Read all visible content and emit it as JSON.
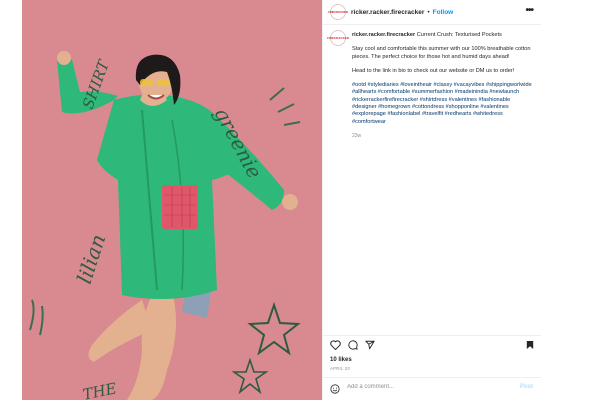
{
  "post_image": {
    "handwriting": [
      "SHIRT",
      "greenie",
      "lilian",
      "THE"
    ]
  },
  "header": {
    "avatar_text": "FIRECRACKER",
    "username": "ricker.racker.firecracker",
    "separator": "•",
    "follow_label": "Follow",
    "more_label": "•••"
  },
  "caption": {
    "avatar_text": "FIRECRACKER",
    "username": "ricker.racker.firecracker",
    "title": "Current Crush: Texturised Pockets",
    "paragraph1": "Stay cool and comfortable this summer with our 100% breathable cotton pieces. The perfect choice for those hot and humid days ahead!",
    "paragraph2": "Head to the link in bio to check out our website or DM us to order!",
    "hashtags": "#ootd #stylediaries #loveintheair #classy #vacayvibes #shippingworlwide #allhearts #comfortable #summerfashion #madeinindia #newlaunch #rickerrackerfirefirecracker #shirtdress #valentines #fashionable #designer #homegrown #cottondress #shopponline #valentines #explorepage #fashionlabel #travelfit #redhearts #whitedress #comfortwear",
    "time": "23w"
  },
  "actions": {
    "icons": [
      "heart-icon",
      "comment-icon",
      "share-icon",
      "save-icon"
    ]
  },
  "likes": "10 likes",
  "date": "APRIL 20",
  "comment": {
    "placeholder": "Add a comment...",
    "post_label": "Post"
  },
  "colors": {
    "background_pink": "#d98a90",
    "shirt_green": "#2eb87a",
    "pocket_pink": "#e0566a",
    "link_blue": "#0095f6",
    "hashtag_blue": "#00376b"
  }
}
